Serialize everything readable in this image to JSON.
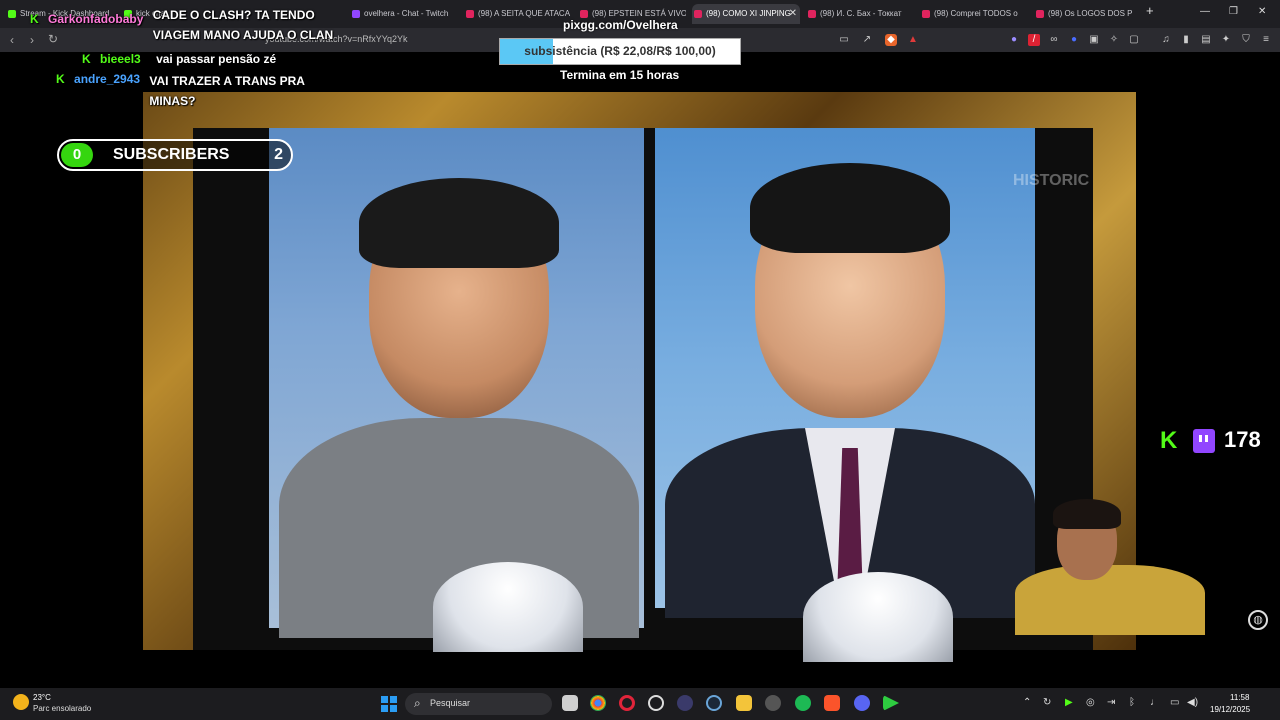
{
  "browser": {
    "tabs": [
      {
        "label": "Stream - Kick Dashboard",
        "active": false
      },
      {
        "label": "kick chat",
        "active": false
      },
      {
        "label": "ovelhera - Chat - Twitch",
        "active": false
      },
      {
        "label": "(98) A SEITA QUE ATACA",
        "active": false
      },
      {
        "label": "(98) EPSTEIN ESTÁ VIVO",
        "active": false
      },
      {
        "label": "(98) COMO XI JINPING",
        "active": true
      },
      {
        "label": "(98) И. С. Бах - Токкат",
        "active": false
      },
      {
        "label": "(98) Comprei TODOS o",
        "active": false
      },
      {
        "label": "(98) Os LOGOS DOS P",
        "active": false
      }
    ],
    "new_tab": "+",
    "url": "youtube.com/watch?v=nRfxYYq2Yk",
    "close_tab": "✕"
  },
  "chat": [
    {
      "user": "Garkonfadobaby",
      "message": "CADE O CLASH? TA TENDO VIAGEM MANO AJUDA O CLAN",
      "user_color": "#ff7ad9"
    },
    {
      "user": "bieeel3",
      "message": "vai passar pensão zé",
      "user_color": "#53fc18"
    },
    {
      "user": "andre_2943",
      "message": "VAI TRAZER A TRANS PRA MINAS?",
      "user_color": "#4aa3ff"
    }
  ],
  "chat_continuation": "MINAS?",
  "chat_line1b": "VIAGEM MANO AJUDA O CLAN",
  "donation": {
    "url": "pixgg.com/Ovelhera",
    "goal_label": "subsistência (R$ 22,08/R$ 100,00)",
    "progress": 0.2208,
    "ends": "Termina em 15 horas"
  },
  "subs": {
    "count": "0",
    "label": "SUBSCRIBERS",
    "goal": "2"
  },
  "viewers": {
    "count": "178"
  },
  "video": {
    "watermark": "HISTORIC"
  },
  "taskbar": {
    "temperature": "23°C",
    "weather": "Parc ensolarado",
    "search_placeholder": "Pesquisar",
    "time": "11:58",
    "date": "19/12/2025"
  },
  "colors": {
    "kick_green": "#53fc18",
    "twitch_purple": "#9146ff",
    "goal_fill": "#5bc8f5"
  }
}
